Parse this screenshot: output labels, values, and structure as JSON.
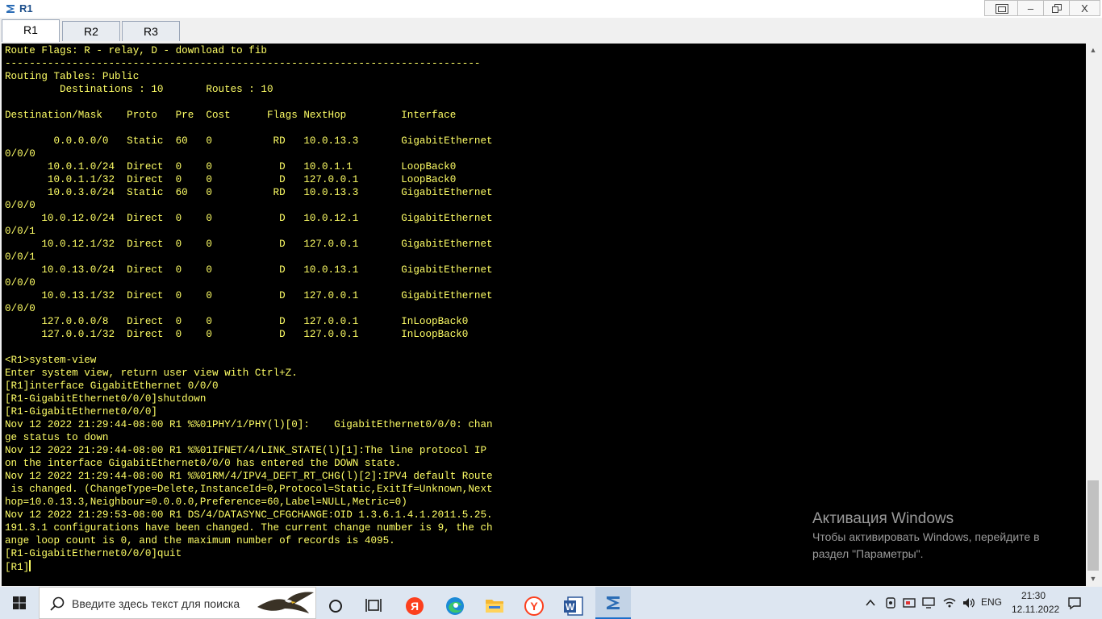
{
  "window": {
    "title": "R1"
  },
  "tabs": [
    {
      "label": "R1",
      "active": true
    },
    {
      "label": "R2",
      "active": false
    },
    {
      "label": "R3",
      "active": false
    }
  ],
  "terminal": {
    "text_color": "#ffff66",
    "background": "#000000",
    "lines": [
      "Route Flags: R - relay, D - download to fib",
      "------------------------------------------------------------------------------",
      "Routing Tables: Public",
      "         Destinations : 10       Routes : 10",
      "",
      "Destination/Mask    Proto   Pre  Cost      Flags NextHop         Interface",
      "",
      "        0.0.0.0/0   Static  60   0          RD   10.0.13.3       GigabitEthernet",
      "0/0/0",
      "       10.0.1.0/24  Direct  0    0           D   10.0.1.1        LoopBack0",
      "       10.0.1.1/32  Direct  0    0           D   127.0.0.1       LoopBack0",
      "       10.0.3.0/24  Static  60   0          RD   10.0.13.3       GigabitEthernet",
      "0/0/0",
      "      10.0.12.0/24  Direct  0    0           D   10.0.12.1       GigabitEthernet",
      "0/0/1",
      "      10.0.12.1/32  Direct  0    0           D   127.0.0.1       GigabitEthernet",
      "0/0/1",
      "      10.0.13.0/24  Direct  0    0           D   10.0.13.1       GigabitEthernet",
      "0/0/0",
      "      10.0.13.1/32  Direct  0    0           D   127.0.0.1       GigabitEthernet",
      "0/0/0",
      "      127.0.0.0/8   Direct  0    0           D   127.0.0.1       InLoopBack0",
      "      127.0.0.1/32  Direct  0    0           D   127.0.0.1       InLoopBack0",
      "",
      "<R1>system-view",
      "Enter system view, return user view with Ctrl+Z.",
      "[R1]interface GigabitEthernet 0/0/0",
      "[R1-GigabitEthernet0/0/0]shutdown",
      "[R1-GigabitEthernet0/0/0]",
      "Nov 12 2022 21:29:44-08:00 R1 %%01PHY/1/PHY(l)[0]:    GigabitEthernet0/0/0: chan",
      "ge status to down",
      "Nov 12 2022 21:29:44-08:00 R1 %%01IFNET/4/LINK_STATE(l)[1]:The line protocol IP",
      "on the interface GigabitEthernet0/0/0 has entered the DOWN state.",
      "Nov 12 2022 21:29:44-08:00 R1 %%01RM/4/IPV4_DEFT_RT_CHG(l)[2]:IPV4 default Route",
      " is changed. (ChangeType=Delete,InstanceId=0,Protocol=Static,ExitIf=Unknown,Next",
      "hop=10.0.13.3,Neighbour=0.0.0.0,Preference=60,Label=NULL,Metric=0)",
      "Nov 12 2022 21:29:53-08:00 R1 DS/4/DATASYNC_CFGCHANGE:OID 1.3.6.1.4.1.2011.5.25.",
      "191.3.1 configurations have been changed. The current change number is 9, the ch",
      "ange loop count is 0, and the maximum number of records is 4095.",
      "[R1-GigabitEthernet0/0/0]quit"
    ],
    "prompt": "[R1]"
  },
  "watermark": {
    "title": "Активация Windows",
    "line1": "Чтобы активировать Windows, перейдите в",
    "line2": "раздел \"Параметры\"."
  },
  "taskbar": {
    "search_placeholder": "Введите здесь текст для поиска",
    "apps": [
      "windows-start-icon",
      "cortana-icon",
      "task-view-icon",
      "yandex-browser-icon",
      "edge-icon",
      "file-explorer-icon",
      "yandex-icon",
      "word-icon",
      "ensp-icon"
    ],
    "language": "ENG",
    "time": "21:30",
    "date": "12.11.2022"
  }
}
